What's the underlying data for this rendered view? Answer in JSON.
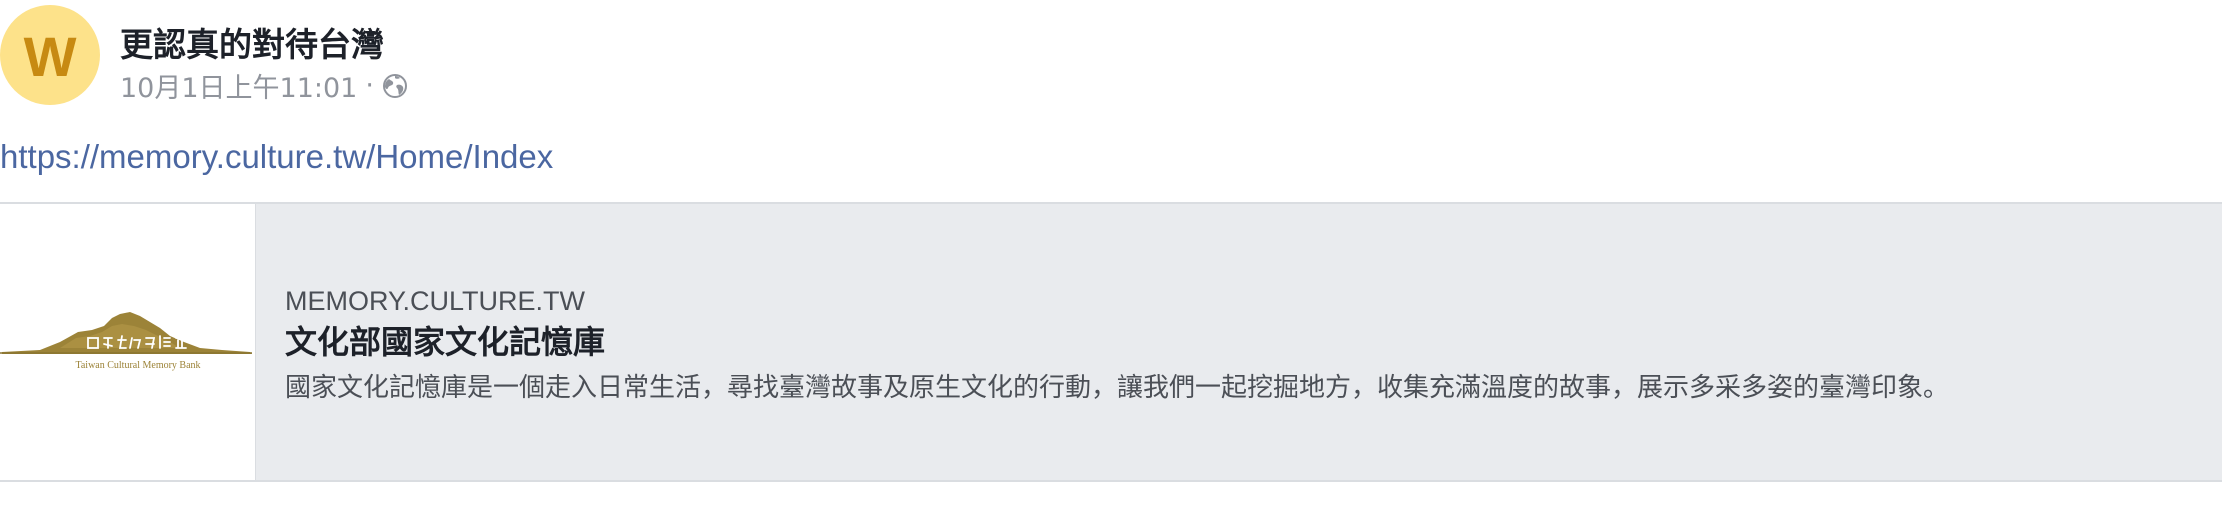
{
  "post": {
    "avatar_letter": "W",
    "page_name": "更認真的對待台灣",
    "timestamp": "10月1日上午11:01",
    "separator": "·",
    "privacy_icon": "globe-icon",
    "link_text": "https://memory.culture.tw/Home/Index"
  },
  "link_preview": {
    "domain": "MEMORY.CULTURE.TW",
    "title": "文化部國家文化記憶庫",
    "description": "國家文化記憶庫是一個走入日常生活，尋找臺灣故事及原生文化的行動，讓我們一起挖掘地方，收集充滿溫度的故事，展示多采多姿的臺灣印象。",
    "logo": {
      "chinese_text": "國家文化記憶庫",
      "english_text": "Taiwan Cultural Memory Bank"
    }
  },
  "colors": {
    "avatar_bg": "#fde28a",
    "avatar_letter": "#c78a12",
    "link": "#4b67a1",
    "card_bg": "#e9ebee",
    "logo_gold": "#9c8338"
  }
}
